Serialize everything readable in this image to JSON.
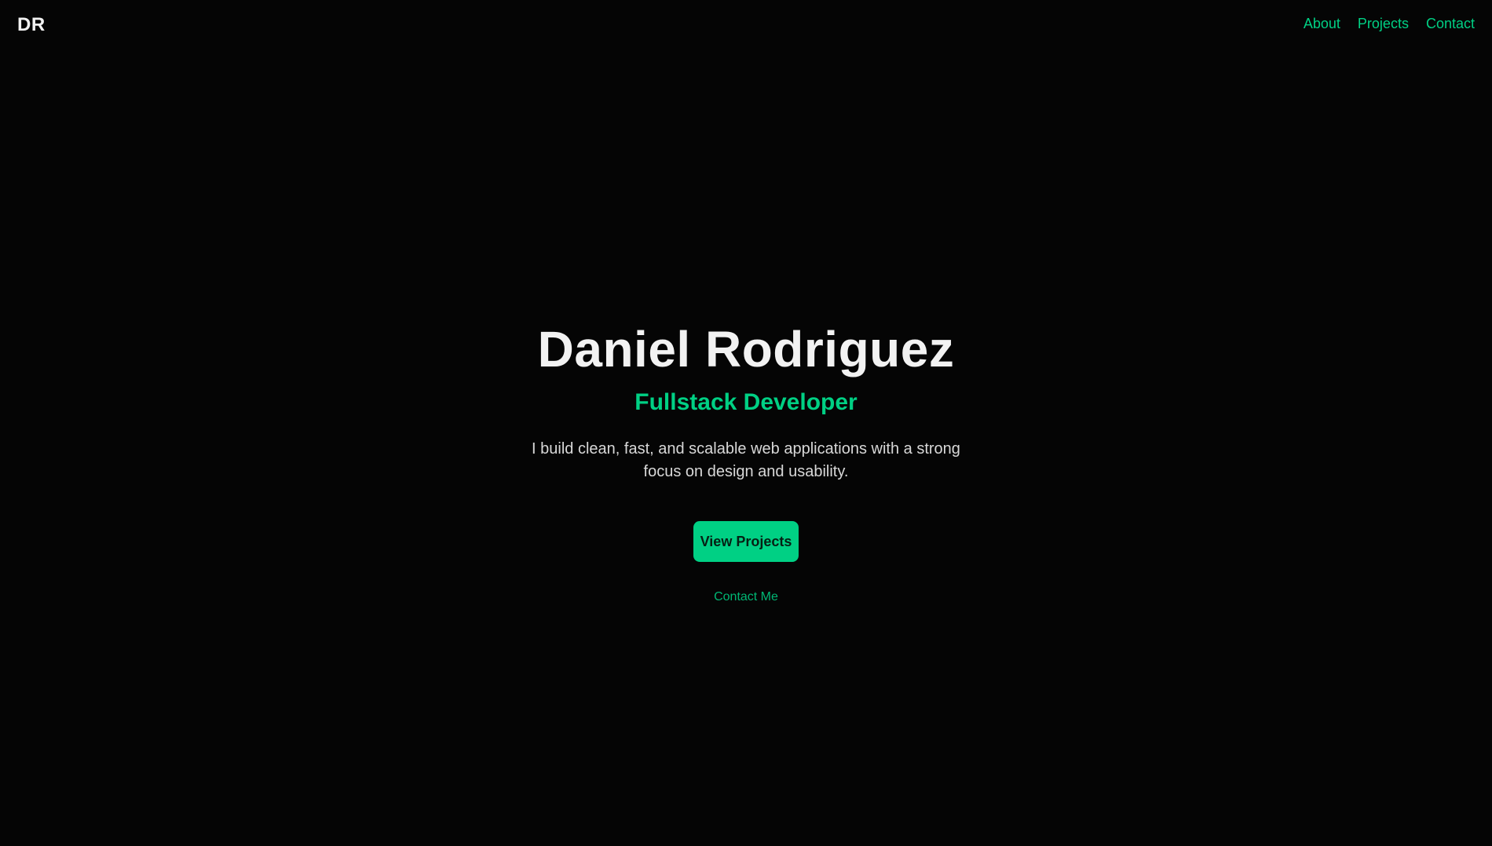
{
  "header": {
    "logo": "DR",
    "nav": [
      {
        "label": "About"
      },
      {
        "label": "Projects"
      },
      {
        "label": "Contact"
      }
    ]
  },
  "hero": {
    "name": "Daniel Rodriguez",
    "role": "Fullstack Developer",
    "description": "I build clean, fast, and scalable web applications with a strong focus on design and usability.",
    "cta_label": "View Projects",
    "secondary_label": "Contact Me"
  },
  "colors": {
    "background": "#050505",
    "accent": "#00d084",
    "text": "#f2f2f2"
  }
}
